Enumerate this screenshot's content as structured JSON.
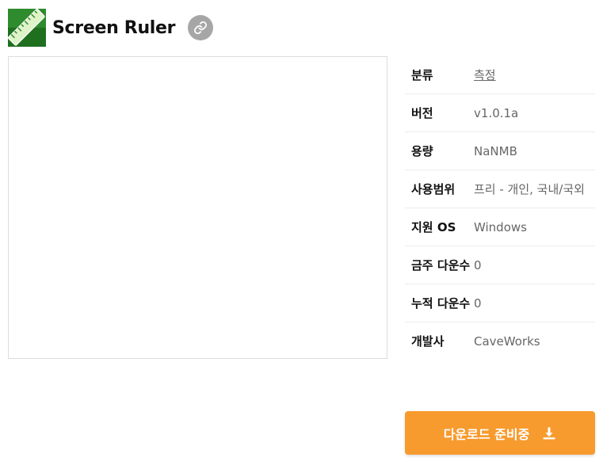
{
  "app": {
    "title": "Screen Ruler",
    "icon": "ruler-icon",
    "icon_color": "#2e8b2e"
  },
  "info": {
    "rows": [
      {
        "label": "분류",
        "value": "측정",
        "link": true
      },
      {
        "label": "버전",
        "value": "v1.0.1a"
      },
      {
        "label": "용량",
        "value": "NaNMB"
      },
      {
        "label": "사용범위",
        "value": "프리 - 개인, 국내/국외"
      },
      {
        "label": "지원 OS",
        "value": "Windows"
      },
      {
        "label": "금주 다운수",
        "value": "0"
      },
      {
        "label": "누적 다운수",
        "value": "0"
      },
      {
        "label": "개발사",
        "value": "CaveWorks"
      }
    ]
  },
  "download": {
    "label": "다운로드 준비중",
    "icon": "download-icon",
    "color": "#f79b2f"
  }
}
